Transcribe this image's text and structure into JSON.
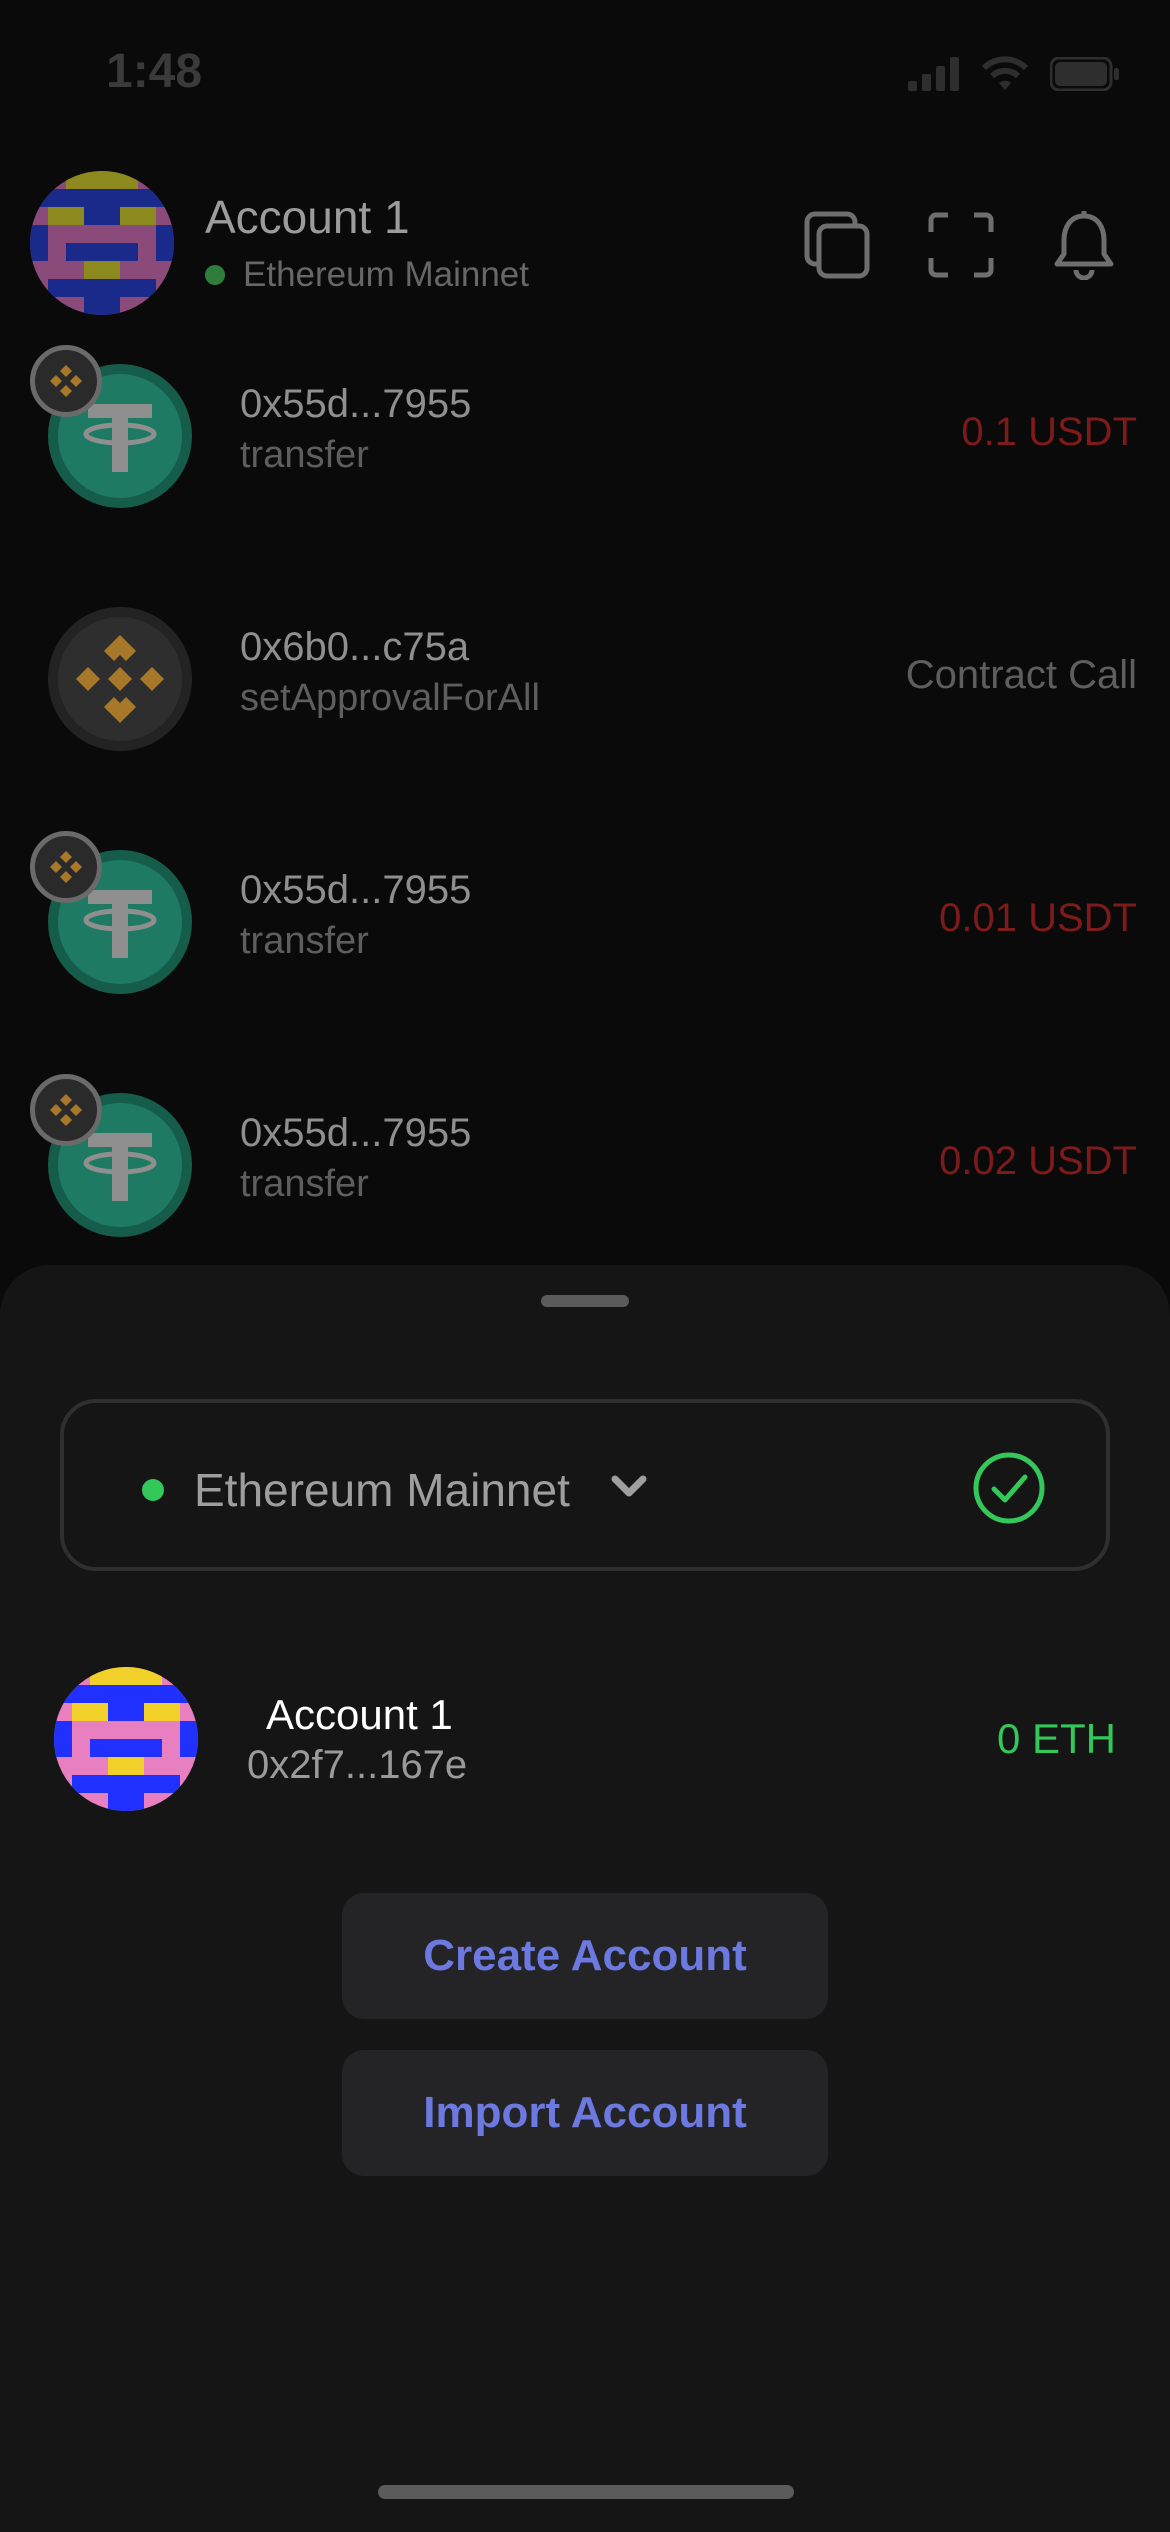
{
  "status_bar": {
    "time": "1:48"
  },
  "header": {
    "account_name": "Account 1",
    "network": "Ethereum Mainnet",
    "icons": [
      "copy-icon",
      "scan-icon",
      "bell-icon"
    ]
  },
  "transactions": [
    {
      "address": "0x55d...7955",
      "method": "transfer",
      "amount": "0.1 USDT",
      "token": "usdt",
      "has_badge": true
    },
    {
      "address": "0x6b0...c75a",
      "method": "setApprovalForAll",
      "amount": "Contract Call",
      "token": "bnb",
      "has_badge": false
    },
    {
      "address": "0x55d...7955",
      "method": "transfer",
      "amount": "0.01 USDT",
      "token": "usdt",
      "has_badge": true
    },
    {
      "address": "0x55d...7955",
      "method": "transfer",
      "amount": "0.02 USDT",
      "token": "usdt",
      "has_badge": true
    }
  ],
  "sheet": {
    "network_selector": {
      "label": "Ethereum Mainnet"
    },
    "account": {
      "name": "Account 1",
      "address": "0x2f7...167e",
      "balance": "0 ETH"
    },
    "buttons": {
      "create": "Create Account",
      "import": "Import Account"
    }
  },
  "colors": {
    "accent": "#6c79e0",
    "positive": "#34c759",
    "negative_dim": "#7d1a1a",
    "usdt_teal": "#1f7a63"
  }
}
